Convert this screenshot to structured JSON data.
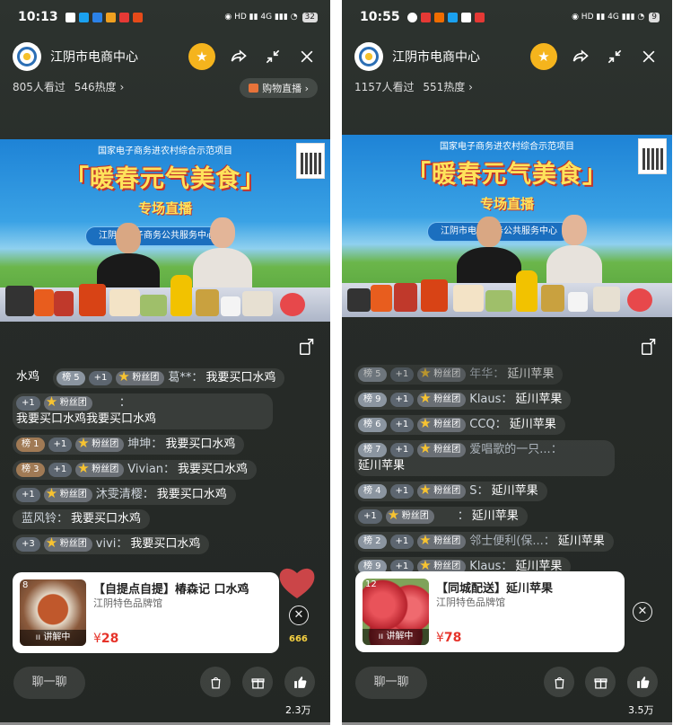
{
  "screens": [
    {
      "time": "10:13",
      "battery": "32",
      "channel_name": "江阴市电商中心",
      "viewers": "805人看过",
      "heat": "546热度 ›",
      "shop_label": "购物直播 ›",
      "banner": {
        "top_text": "国家电子商务进农村综合示范项目",
        "title": "「暖春元气美食」",
        "subtitle": "专场直播",
        "pill": "江阴市电子商务公共服务中心"
      },
      "comments": [
        {
          "badges": [],
          "name": "",
          "text": "水鸡",
          "plain": true
        },
        {
          "badges": [
            "榜 5",
            "+1",
            "粉丝团"
          ],
          "name": "葛**：",
          "text": "我要买口水鸡"
        },
        {
          "badges": [
            "+1",
            "粉丝团"
          ],
          "name": "：",
          "text": "我要买口水鸡我要买口水鸡"
        },
        {
          "badges": [
            "榜 1",
            "+1",
            "粉丝团"
          ],
          "name": "坤坤：",
          "text": "我要买口水鸡"
        },
        {
          "badges": [
            "榜 3",
            "+1",
            "粉丝团"
          ],
          "name": "Vivian：",
          "text": "我要买口水鸡"
        },
        {
          "badges": [
            "+1",
            "粉丝团"
          ],
          "name": "沐雯清樱：",
          "text": "我要买口水鸡"
        },
        {
          "badges": [],
          "name": "蓝风铃：",
          "text": "我要买口水鸡"
        },
        {
          "badges": [
            "+3",
            "粉丝团"
          ],
          "name": "vivi：",
          "text": "我要买口水鸡"
        }
      ],
      "product": {
        "index": "8",
        "title": "【自提点自提】椿森记 口水鸡",
        "store": "江阴特色品牌馆",
        "live_label": "讲解中",
        "price_symbol": "¥",
        "price": "28"
      },
      "chat_placeholder": "聊一聊",
      "likes": "2.3万",
      "bubble_count": "666"
    },
    {
      "time": "10:55",
      "battery": "9",
      "channel_name": "江阴市电商中心",
      "viewers": "1157人看过",
      "heat": "551热度 ›",
      "banner": {
        "top_text": "国家电子商务进农村综合示范项目",
        "title": "「暖春元气美食」",
        "subtitle": "专场直播",
        "pill": "江阴市电子商务公共服务中心"
      },
      "comments": [
        {
          "badges": [
            "榜 5",
            "+1",
            "粉丝团"
          ],
          "name": "年华：",
          "text": "延川苹果"
        },
        {
          "badges": [
            "榜 9",
            "+1",
            "粉丝团"
          ],
          "name": "Klaus：",
          "text": "延川苹果"
        },
        {
          "badges": [
            "榜 6",
            "+1",
            "粉丝团"
          ],
          "name": "CCQ：",
          "text": "延川苹果"
        },
        {
          "badges": [
            "榜 7",
            "+1",
            "粉丝团"
          ],
          "name": "爱唱歌的一只...：",
          "text": "延川苹果"
        },
        {
          "badges": [
            "榜 4",
            "+1",
            "粉丝团"
          ],
          "name": "S：",
          "text": "延川苹果"
        },
        {
          "badges": [
            "+1",
            "粉丝团"
          ],
          "name": "：",
          "text": "延川苹果"
        },
        {
          "badges": [
            "榜 2",
            "+1",
            "粉丝团"
          ],
          "name": "邻士便利(保...：",
          "text": "延川苹果"
        },
        {
          "badges": [
            "榜 9",
            "+1",
            "粉丝团"
          ],
          "name": "Klaus：",
          "text": "延川苹果"
        }
      ],
      "product": {
        "index": "12",
        "title": "【同城配送】延川苹果",
        "store": "江阴特色品牌馆",
        "live_label": "讲解中",
        "price_symbol": "¥",
        "price": "78"
      },
      "chat_placeholder": "聊一聊",
      "likes": "3.5万"
    }
  ],
  "colors": {
    "accent": "#f5b41d",
    "price": "#e6332a",
    "banner_title": "#ffe35b"
  },
  "icons": [
    "star-icon",
    "share-icon",
    "minimize-icon",
    "close-icon",
    "rotate-screen-icon",
    "shopping-bag-icon",
    "gift-icon",
    "like-icon"
  ]
}
